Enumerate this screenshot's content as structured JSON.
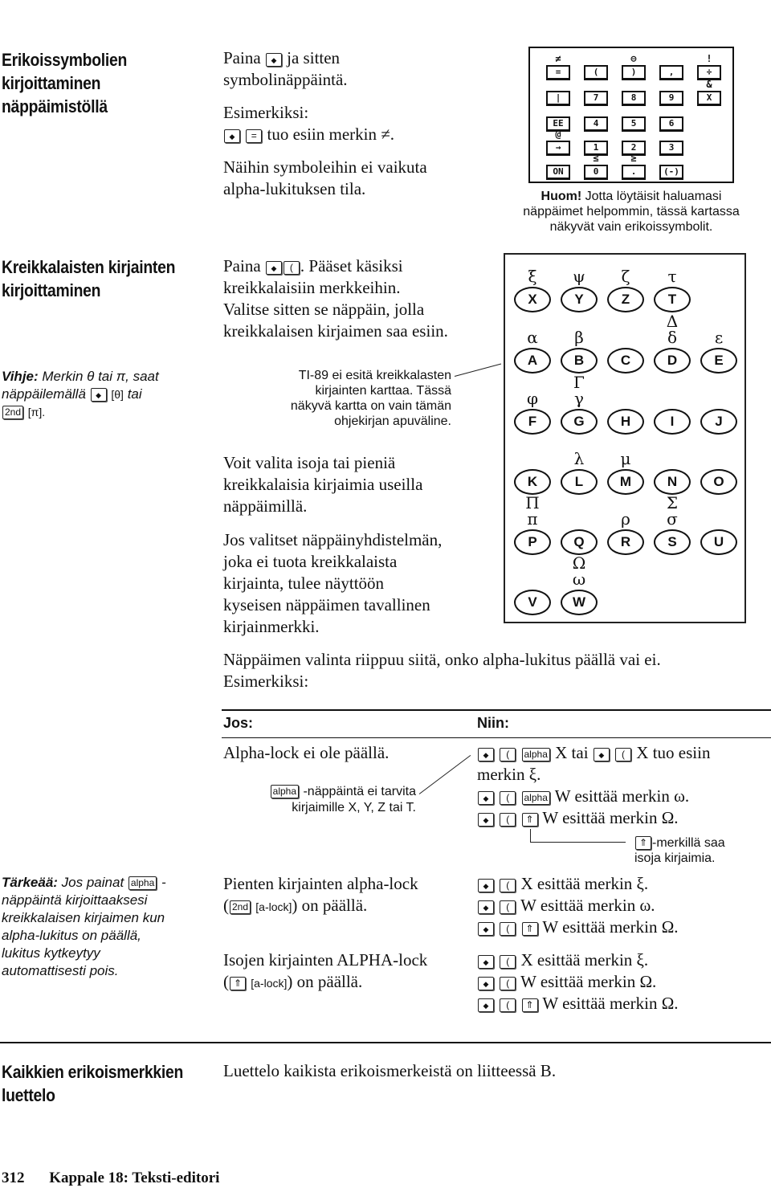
{
  "section1": {
    "heading": [
      "Erikoissymbolien",
      "kirjoittaminen",
      "näppäimistöllä"
    ],
    "p1_a": "Paina",
    "p1_b": "ja sitten",
    "p1_c": "symbolinäppäintä.",
    "p2_a": "Esimerkiksi:",
    "p2_key2": "=",
    "p2_b": "tuo esiin merkin ≠.",
    "p3": [
      "Näihin symboleihin ei vaikuta",
      "alpha-lukituksen tila."
    ],
    "keymap": {
      "rows": [
        [
          {
            "k": "=",
            "s": "≠"
          },
          {
            "k": "(",
            "s": ""
          },
          {
            "k": ")",
            "s": "⊖"
          },
          {
            "k": ",",
            "s": ""
          },
          {
            "k": "÷",
            "s": "!"
          }
        ],
        [
          {
            "k": "|",
            "s": ""
          },
          {
            "k": "7",
            "s": ""
          },
          {
            "k": "8",
            "s": ""
          },
          {
            "k": "9",
            "s": ""
          },
          {
            "k": "X",
            "s": "&"
          }
        ],
        [
          {
            "k": "EE",
            "s": ""
          },
          {
            "k": "4",
            "s": ""
          },
          {
            "k": "5",
            "s": ""
          },
          {
            "k": "6",
            "s": ""
          }
        ],
        [
          {
            "k": "→",
            "s": "@"
          },
          {
            "k": "1",
            "s": ""
          },
          {
            "k": "2",
            "s": ""
          },
          {
            "k": "3",
            "s": ""
          }
        ],
        [
          {
            "k": "ON",
            "s": ""
          },
          {
            "k": "0",
            "s": "≤"
          },
          {
            "k": ".",
            "s": "≥"
          },
          {
            "k": "(-)",
            "s": ""
          }
        ]
      ]
    },
    "note_bold": "Huom!",
    "note": [
      "Jotta löytäisit haluamasi",
      "näppäimet helpommin, tässä kartassa",
      "näkyvät vain erikoissymbolit."
    ]
  },
  "section2": {
    "heading": [
      "Kreikkalaisten kirjainten",
      "kirjoittaminen"
    ],
    "p1_a": "Paina",
    "p1_key2": "(",
    "p1_b": ". Pääset käsiksi",
    "p1_lines": [
      "kreikkalaisiin merkkeihin.",
      "Valitse sitten se näppäin, jolla",
      "kreikkalaisen kirjaimen saa esiin."
    ],
    "tip_bold": "Vihje:",
    "tip_a": "Merkin θ tai π, saat",
    "tip_b": "näppäilemällä",
    "tip_theta": "[θ]",
    "tip_c": "tai",
    "tip_2nd": "2nd",
    "tip_pi": "[π].",
    "caption": [
      "TI-89 ei esitä kreikkalasten",
      "kirjainten karttaa. Tässä",
      "näkyvä kartta on vain tämän",
      "ohjekirjan apuväline."
    ],
    "p2": [
      "Voit valita isoja tai pieniä",
      "kreikkalaisia kirjaimia useilla",
      "näppäimillä."
    ],
    "p3": [
      "Jos valitset näppäinyhdistelmän,",
      "joka ei tuota kreikkalaista",
      "kirjainta, tulee näyttöön",
      "kyseisen näppäimen tavallinen",
      "kirjainmerkki."
    ],
    "greek_map": {
      "rows": [
        [
          {
            "k": "X",
            "g": "ξ"
          },
          {
            "k": "Y",
            "g": "ψ"
          },
          {
            "k": "Z",
            "g": "ζ"
          },
          {
            "k": "T",
            "g": "τ"
          }
        ],
        [
          {
            "k": "A",
            "g": "α"
          },
          {
            "k": "B",
            "g": "β"
          },
          {
            "k": "C",
            "g": ""
          },
          {
            "k": "D",
            "g": "δ",
            "G": "Δ"
          },
          {
            "k": "E",
            "g": "ε"
          }
        ],
        [
          {
            "k": "F",
            "g": "φ"
          },
          {
            "k": "G",
            "g": "γ",
            "G": "Γ"
          },
          {
            "k": "H",
            "g": ""
          },
          {
            "k": "I",
            "g": ""
          },
          {
            "k": "J",
            "g": ""
          }
        ],
        [
          {
            "k": "K",
            "g": ""
          },
          {
            "k": "L",
            "g": "λ"
          },
          {
            "k": "M",
            "g": "μ"
          },
          {
            "k": "N",
            "g": ""
          },
          {
            "k": "O",
            "g": ""
          }
        ],
        [
          {
            "k": "P",
            "g": "π",
            "G": "Π"
          },
          {
            "k": "Q",
            "g": ""
          },
          {
            "k": "R",
            "g": "ρ"
          },
          {
            "k": "S",
            "g": "σ",
            "G": "Σ"
          },
          {
            "k": "U",
            "g": ""
          }
        ],
        [
          {
            "k": "V",
            "g": ""
          },
          {
            "k": "W",
            "g": "ω",
            "G": "Ω"
          }
        ]
      ]
    },
    "p4": [
      "Näppäimen valinta riippuu siitä, onko alpha-lukitus päällä vai ei.",
      "Esimerkiksi:"
    ]
  },
  "table": {
    "col_if": "Jos:",
    "col_then": "Niin:",
    "row1": {
      "if": "Alpha-lock ei ole päällä.",
      "callout_key": "alpha",
      "callout": [
        "-näppäintä ei tarvita",
        "kirjaimille X, Y, Z tai T."
      ],
      "lines": [
        {
          "keys": [
            "◆",
            "(",
            "alpha"
          ],
          "text": "X tai",
          "keys2": [
            "◆",
            "("
          ],
          "text2": "X tuo esiin"
        },
        {
          "text": "merkin ξ."
        },
        {
          "keys": [
            "◆",
            "(",
            "alpha"
          ],
          "text": "W esittää merkin ω."
        },
        {
          "keys": [
            "◆",
            "(",
            "⇑"
          ],
          "text": "W esittää merkin Ω."
        }
      ],
      "shift_note_key": "⇑",
      "shift_note": [
        "-merkillä saa",
        "isoja kirjaimia."
      ]
    },
    "row2": {
      "if": [
        "Pienten kirjainten alpha-lock",
        "on päällä."
      ],
      "if_keys": [
        "2nd",
        "[a-lock]"
      ],
      "lines": [
        {
          "keys": [
            "◆",
            "("
          ],
          "text": "X esittää merkin ξ."
        },
        {
          "keys": [
            "◆",
            "("
          ],
          "text": "W esittää merkin ω."
        },
        {
          "keys": [
            "◆",
            "(",
            "⇑"
          ],
          "text": "W esittää merkin Ω."
        }
      ]
    },
    "row3": {
      "if": [
        "Isojen kirjainten ALPHA-lock",
        "on päällä."
      ],
      "if_keys": [
        "⇑",
        "[a-lock]"
      ],
      "lines": [
        {
          "keys": [
            "◆",
            "("
          ],
          "text": "X esittää merkin ξ."
        },
        {
          "keys": [
            "◆",
            "("
          ],
          "text": "W esittää merkin Ω."
        },
        {
          "keys": [
            "◆",
            "(",
            "⇑"
          ],
          "text": "W esittää merkin Ω."
        }
      ]
    },
    "important_bold": "Tärkeää:",
    "important_a": "Jos painat",
    "important_key": "alpha",
    "important_lines": [
      "näppäintä kirjoittaaksesi",
      "kreikkalaisen kirjaimen kun",
      "alpha-lukitus on päällä,",
      "lukitus kytkeytyy",
      "automattisesti pois."
    ]
  },
  "section3": {
    "heading": [
      "Kaikkien erikoismerkkien",
      "luettelo"
    ],
    "text": "Luettelo kaikista erikoismerkeistä on liitteessä B."
  },
  "footer": {
    "page": "312",
    "chapter": "Kappale 18: Teksti-editori"
  }
}
